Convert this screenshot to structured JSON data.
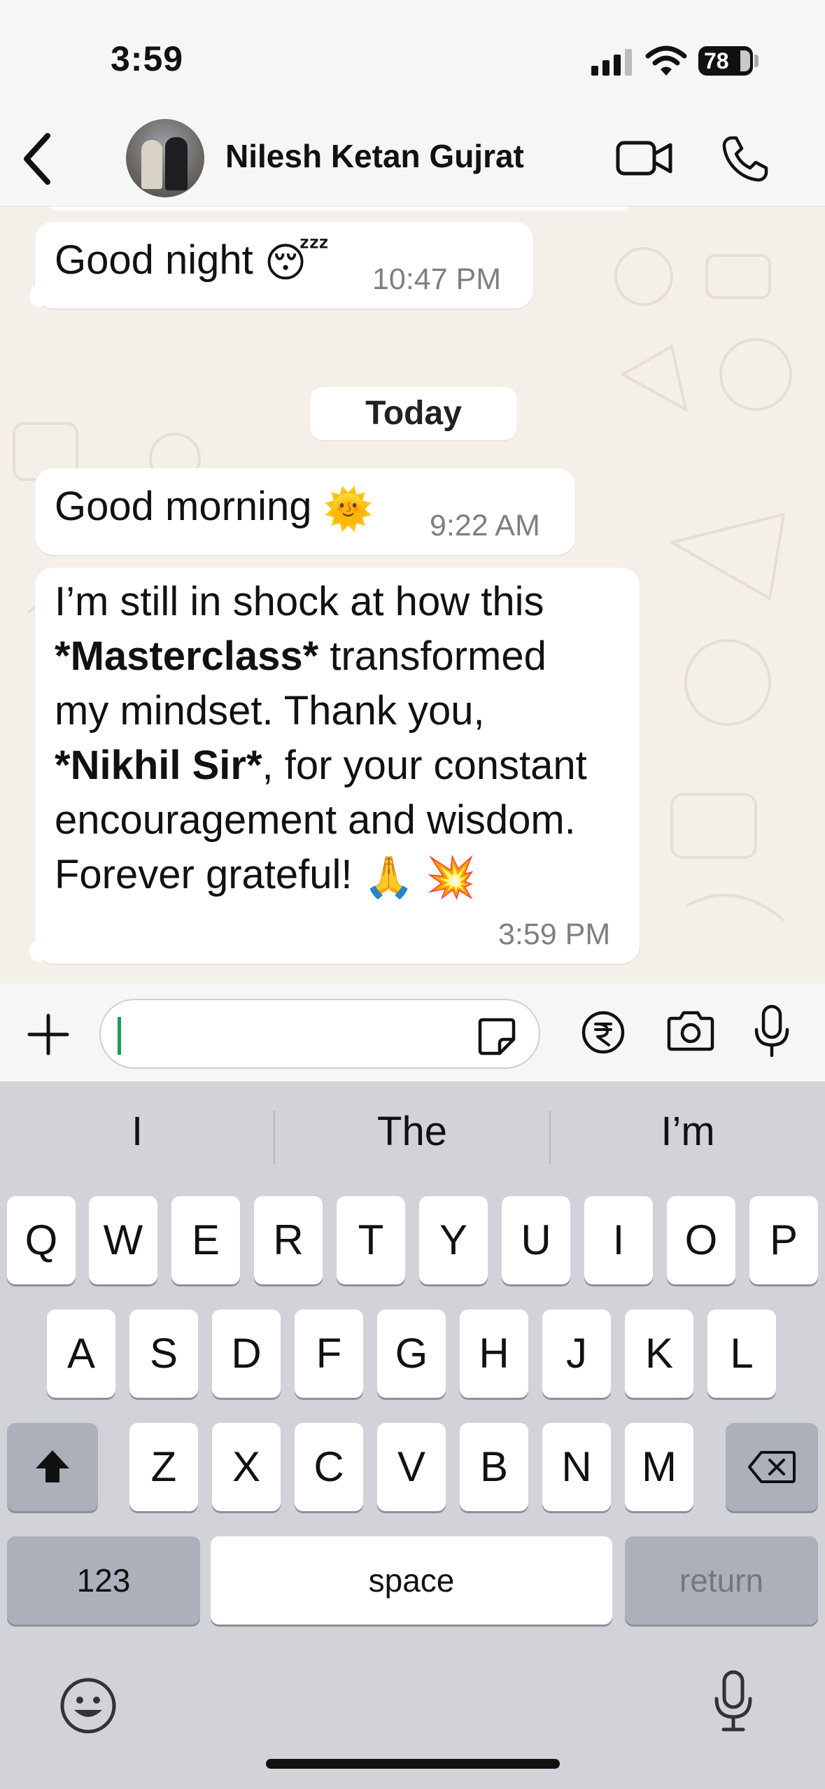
{
  "status_bar": {
    "time": "3:59",
    "battery": "78"
  },
  "header": {
    "contact_name": "Nilesh Ketan Gujrat"
  },
  "chat": {
    "messages": [
      {
        "text": "Good night",
        "emoji": "😴",
        "time": "10:47 PM"
      },
      {
        "date_separator": "Today"
      },
      {
        "text": "Good morning",
        "emoji": "🌞",
        "time": "9:22 AM"
      },
      {
        "line1": "I’m still in shock at how this",
        "line2_bold": "*Masterclass*",
        "line2_rest": " transformed",
        "line3": "my mindset. Thank you,",
        "line4_bold": "*Nikhil Sir*",
        "line4_rest": ", for your constant",
        "line5": "encouragement and wisdom.",
        "line6": "Forever grateful!",
        "line6_emoji": "🙏 💥",
        "time": "3:59 PM"
      }
    ]
  },
  "input": {
    "value": "",
    "placeholder": ""
  },
  "keyboard": {
    "suggestions": [
      "I",
      "The",
      "I’m"
    ],
    "row1": [
      "Q",
      "W",
      "E",
      "R",
      "T",
      "Y",
      "U",
      "I",
      "O",
      "P"
    ],
    "row2": [
      "A",
      "S",
      "D",
      "F",
      "G",
      "H",
      "J",
      "K",
      "L"
    ],
    "row3": [
      "Z",
      "X",
      "C",
      "V",
      "B",
      "N",
      "M"
    ],
    "numbers_label": "123",
    "space_label": "space",
    "return_label": "return"
  },
  "icons": {
    "back": "chevron-left-icon",
    "video": "video-camera-icon",
    "call": "phone-icon",
    "plus": "plus-icon",
    "sticker": "sticker-icon",
    "payment": "rupee-icon",
    "camera": "camera-icon",
    "mic": "microphone-icon",
    "emoji": "emoji-icon",
    "shift": "shift-icon",
    "delete": "backspace-icon"
  },
  "colors": {
    "chat_background": "#f4efe8",
    "caret": "#1a9e58",
    "keyboard": "#d1d3d9"
  }
}
